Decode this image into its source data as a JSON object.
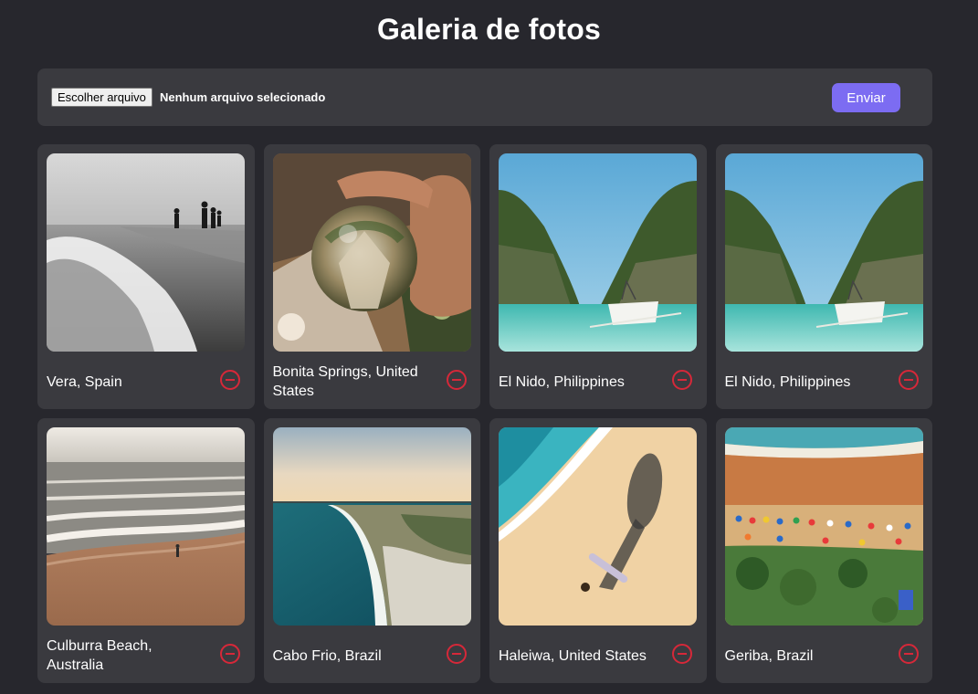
{
  "header": {
    "title": "Galeria de fotos"
  },
  "upload": {
    "choose_file_label": "Escolher arquivo",
    "no_file_text": "Nenhum arquivo selecionado",
    "submit_label": "Enviar"
  },
  "colors": {
    "background": "#27272d",
    "card": "#3a3a3f",
    "accent": "#7c6cf2",
    "delete": "#d62839"
  },
  "gallery": [
    {
      "location": "Vera, Spain",
      "photo": "black-and-white beach waves with people"
    },
    {
      "location": "Bonita Springs, United States",
      "photo": "hand holding crystal ball over boardwalk"
    },
    {
      "location": "El Nido, Philippines",
      "photo": "limestone cliffs with boat on turquoise water"
    },
    {
      "location": "El Nido, Philippines",
      "photo": "limestone cliffs with boat on turquoise water"
    },
    {
      "location": "Culburra Beach, Australia",
      "photo": "aerial beach with waves and lone person"
    },
    {
      "location": "Cabo Frio, Brazil",
      "photo": "aerial coastline at sunset"
    },
    {
      "location": "Haleiwa, United States",
      "photo": "surfer shadow on sand beside waves"
    },
    {
      "location": "Geriba, Brazil",
      "photo": "aerial beach with umbrellas and trees"
    }
  ],
  "icons": {
    "delete": "minus-circle-icon"
  }
}
